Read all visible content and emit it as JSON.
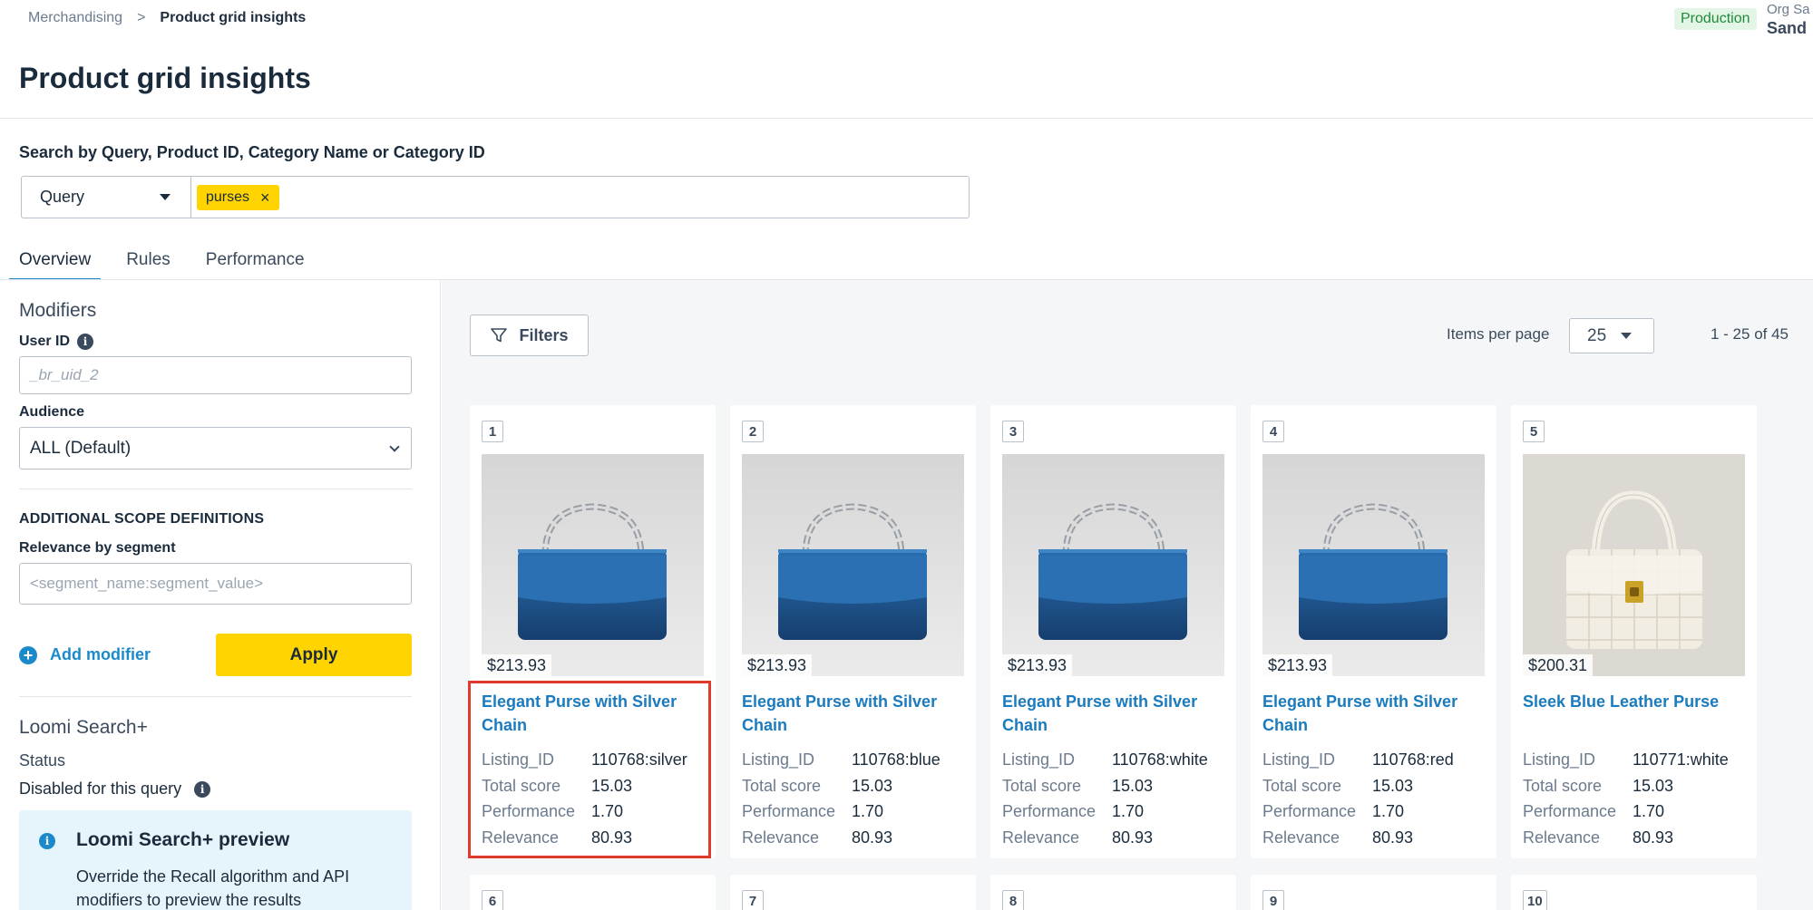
{
  "breadcrumb": {
    "parent": "Merchandising",
    "separator": ">",
    "current": "Product grid insights"
  },
  "environment": "Production",
  "org": {
    "label": "Org Sa",
    "name": "Sand"
  },
  "page_title": "Product grid insights",
  "search": {
    "label": "Search by Query, Product ID, Category Name or Category ID",
    "type": "Query",
    "chip": "purses",
    "chip_remove": "×"
  },
  "tabs": [
    "Overview",
    "Rules",
    "Performance"
  ],
  "sidebar": {
    "modifiers_heading": "Modifiers",
    "user_id_label": "User ID",
    "user_id_placeholder": "_br_uid_2",
    "audience_label": "Audience",
    "audience_value": "ALL (Default)",
    "scope_heading": "ADDITIONAL SCOPE DEFINITIONS",
    "relevance_label": "Relevance by segment",
    "relevance_placeholder": "<segment_name:segment_value>",
    "add_modifier": "Add modifier",
    "apply": "Apply",
    "loomi_heading": "Loomi Search+",
    "status_label": "Status",
    "status_value": "Disabled for this query",
    "preview_title": "Loomi Search+ preview",
    "preview_body": "Override the Recall algorithm and API modifiers to preview the results"
  },
  "toolbar": {
    "filters": "Filters",
    "items_per_page_label": "Items per page",
    "items_per_page": "25",
    "range": "1 - 25 of 45"
  },
  "meta_labels": {
    "listing": "Listing_ID",
    "total": "Total score",
    "performance": "Performance",
    "relevance": "Relevance"
  },
  "products": [
    {
      "rank": "1",
      "price": "$213.93",
      "name": "Elegant Purse with Silver Chain",
      "listing_id": "110768:silver",
      "total_score": "15.03",
      "performance": "1.70",
      "relevance": "80.93",
      "image": "blue-chain-purse"
    },
    {
      "rank": "2",
      "price": "$213.93",
      "name": "Elegant Purse with Silver Chain",
      "listing_id": "110768:blue",
      "total_score": "15.03",
      "performance": "1.70",
      "relevance": "80.93",
      "image": "blue-chain-purse"
    },
    {
      "rank": "3",
      "price": "$213.93",
      "name": "Elegant Purse with Silver Chain",
      "listing_id": "110768:white",
      "total_score": "15.03",
      "performance": "1.70",
      "relevance": "80.93",
      "image": "blue-chain-purse"
    },
    {
      "rank": "4",
      "price": "$213.93",
      "name": "Elegant Purse with Silver Chain",
      "listing_id": "110768:red",
      "total_score": "15.03",
      "performance": "1.70",
      "relevance": "80.93",
      "image": "blue-chain-purse"
    },
    {
      "rank": "5",
      "price": "$200.31",
      "name": "Sleek Blue Leather Purse",
      "listing_id": "110771:white",
      "total_score": "15.03",
      "performance": "1.70",
      "relevance": "80.93",
      "image": "white-woven-purse"
    }
  ],
  "next_row_ranks": [
    "6",
    "7",
    "8",
    "9",
    "10"
  ],
  "colors": {
    "accent": "#1a8acb",
    "primary_button": "#ffd400",
    "link": "#1a7bbf",
    "highlight": "#e03a2b",
    "env_badge": "#1f8a3a"
  }
}
